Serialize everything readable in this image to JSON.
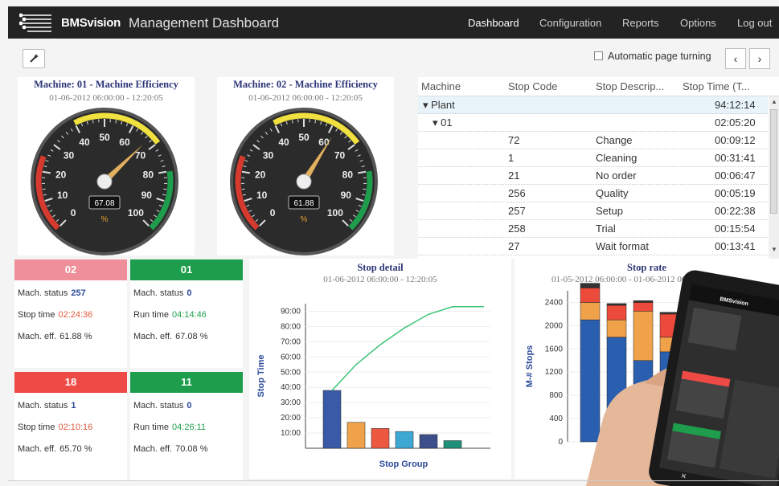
{
  "app": {
    "brand": "BMSvision",
    "title": "Management Dashboard"
  },
  "nav": [
    {
      "label": "Dashboard",
      "active": true
    },
    {
      "label": "Configuration",
      "active": false
    },
    {
      "label": "Reports",
      "active": false
    },
    {
      "label": "Options",
      "active": false
    },
    {
      "label": "Log out",
      "active": false
    }
  ],
  "toolbar": {
    "tool_icon": "magic-wand-icon",
    "auto_turn_label": "Automatic page turning",
    "auto_turn_checked": false,
    "prev": "‹",
    "next": "›"
  },
  "gauges": [
    {
      "title": "Machine: 01 - Machine Efficiency",
      "subtitle": "01-06-2012 06:00:00 - 12:20:05",
      "value": 67.08,
      "display": "67.08",
      "unit": "%"
    },
    {
      "title": "Machine: 02 - Machine Efficiency",
      "subtitle": "01-06-2012 06:00:00 - 12:20:05",
      "value": 61.88,
      "display": "61.88",
      "unit": "%"
    }
  ],
  "gauge_ticks": [
    "0",
    "10",
    "20",
    "30",
    "40",
    "50",
    "60",
    "70",
    "80",
    "90",
    "100"
  ],
  "grid": {
    "headers": [
      "Machine",
      "Stop Code",
      "Stop Descrip...",
      "Stop Time (T..."
    ],
    "rows": [
      {
        "machine": "▾ Plant",
        "code": "",
        "desc": "",
        "time": "94:12:14",
        "kind": "plant"
      },
      {
        "machine": "▾ 01",
        "code": "",
        "desc": "",
        "time": "02:05:20",
        "kind": "group"
      },
      {
        "machine": "",
        "code": "72",
        "desc": "Change",
        "time": "00:09:12",
        "kind": "item"
      },
      {
        "machine": "",
        "code": "1",
        "desc": "Cleaning",
        "time": "00:31:41",
        "kind": "item"
      },
      {
        "machine": "",
        "code": "21",
        "desc": "No order",
        "time": "00:06:47",
        "kind": "item"
      },
      {
        "machine": "",
        "code": "256",
        "desc": "Quality",
        "time": "00:05:19",
        "kind": "item"
      },
      {
        "machine": "",
        "code": "257",
        "desc": "Setup",
        "time": "00:22:38",
        "kind": "item"
      },
      {
        "machine": "",
        "code": "258",
        "desc": "Trial",
        "time": "00:15:54",
        "kind": "item"
      },
      {
        "machine": "",
        "code": "27",
        "desc": "Wait format",
        "time": "00:13:41",
        "kind": "item"
      }
    ]
  },
  "cards": [
    {
      "machine": "02",
      "color": "#ee8f9a",
      "status_label": "Mach. status",
      "status": "257",
      "time_label": "Stop time",
      "time": "02:24:36",
      "time_color": "#e05a3a",
      "eff_label": "Mach. eff.",
      "eff": "61.88 %"
    },
    {
      "machine": "01",
      "color": "#1e9e4c",
      "status_label": "Mach. status",
      "status": "0",
      "time_label": "Run time",
      "time": "04:14:46",
      "time_color": "#1e9e4c",
      "eff_label": "Mach. eff.",
      "eff": "67.08 %"
    },
    {
      "machine": "18",
      "color": "#ee4a45",
      "status_label": "Mach. status",
      "status": "1",
      "time_label": "Stop time",
      "time": "02:10:16",
      "time_color": "#e05a3a",
      "eff_label": "Mach. eff.",
      "eff": "65.70 %"
    },
    {
      "machine": "11",
      "color": "#1e9e4c",
      "status_label": "Mach. status",
      "status": "0",
      "time_label": "Run time",
      "time": "04:26:11",
      "time_color": "#1e9e4c",
      "eff_label": "Mach. eff.",
      "eff": "70.08 %"
    }
  ],
  "chart_data": [
    {
      "type": "bar",
      "title": "Stop detail",
      "subtitle": "01-06-2012 06:00:00 - 12:20:05",
      "xlabel": "Stop Group",
      "ylabel": "Stop Time",
      "yticks": [
        "10:00",
        "20:00",
        "30:00",
        "40:00",
        "50:00",
        "60:00",
        "70:00",
        "80:00",
        "90:00"
      ],
      "ylim": [
        0,
        95
      ],
      "values": [
        38,
        17,
        13,
        11,
        9,
        5
      ],
      "colors": [
        "#3a5aa8",
        "#f0a24a",
        "#ec5840",
        "#3ea8d4",
        "#3d4f8a",
        "#1e8f78"
      ],
      "cumulative_line": [
        38,
        55,
        68,
        79,
        88,
        93
      ],
      "line_color": "#3cc47a"
    },
    {
      "type": "bar",
      "title": "Stop rate",
      "subtitle": "01-05-2012 06:00:00 - 01-06-2012 06:00",
      "ylabel": "M-# Stops",
      "yticks": [
        "0",
        "200",
        "400",
        "600",
        "800",
        "1000",
        "1200",
        "1400",
        "1600",
        "1800",
        "2000",
        "2200",
        "2400"
      ],
      "ylim": [
        0,
        2600
      ],
      "stacked": true,
      "series": [
        {
          "values": [
            2100,
            1800,
            1400,
            1550,
            1850
          ],
          "color": "#2a5fb0"
        },
        {
          "values": [
            300,
            300,
            850,
            250,
            250
          ],
          "color": "#f0a24a"
        },
        {
          "values": [
            250,
            250,
            150,
            400,
            150
          ],
          "color": "#ec4a3a"
        },
        {
          "values": [
            80,
            30,
            30,
            30,
            30
          ],
          "color": "#333333"
        }
      ]
    }
  ],
  "tablet": {
    "brand": "BMSvision",
    "cards": [
      "#ee4a45",
      "#1e9e4c"
    ]
  }
}
